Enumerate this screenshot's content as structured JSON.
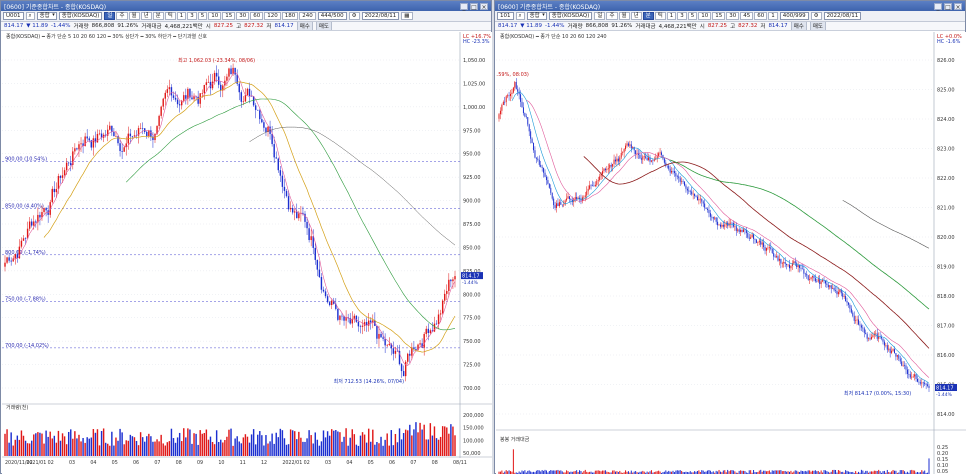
{
  "left_window": {
    "title": "[0600] 기준종합차트 - 종합(KOSDAQ)",
    "toolbar": {
      "code": "U001",
      "market": "종합",
      "name": "종합(KOSDAQ)",
      "period_buttons": [
        "일",
        "주",
        "월",
        "년",
        "분",
        "틱",
        "1",
        "3",
        "5",
        "10",
        "15",
        "30",
        "60",
        "120",
        "180",
        "240"
      ],
      "active_period": "일",
      "count": "444/500",
      "date": "2022/08/11"
    },
    "info_bar": {
      "price": "814.17",
      "change": "▼ 11.89",
      "change_pct": "-1.44%",
      "volume_label": "거래량",
      "volume": "866,808",
      "volume_ratio": "91.26%",
      "amount_label": "거래대금",
      "amount": "4,468,221백만",
      "open_label": "시",
      "open": "827.25",
      "high_label": "고",
      "high": "827.32",
      "low_label": "저",
      "low": "814.17",
      "buttons": [
        "매수",
        "매도"
      ]
    },
    "price_legend": "종합(KOSDAQ) ━ 종가 단순 5 10 20 60 120 ━ 30% 상단가 ━ 30% 하단가 ━ 단기과열 신호",
    "price_axis": [
      "1,050.00",
      "1,025.00",
      "1,000.00",
      "975.00",
      "950.00",
      "925.00",
      "900.00",
      "875.00",
      "850.00",
      "825.00",
      "800.00",
      "775.00",
      "750.00",
      "725.00",
      "700.00"
    ],
    "level_labels": [
      "900.00 (10.54%)",
      "850.00 (4.40%)",
      "800.00 (-1.74%)",
      "750.00 (-7.88%)",
      "700.00 (-14.02%)"
    ],
    "high_annotation": "최고 1,062.03 (-23.34%, 08/06)",
    "low_annotation": "최저 712.53 (14.26%, 07/04)",
    "last_price_tag": "814.17",
    "last_change_tag": "-1.44%",
    "corner_top": "LC +16.7%",
    "corner_sub": "HC -23.3%",
    "volume_legend": "거래량(천)",
    "volume_axis": [
      "200,000",
      "150,000",
      "100,000",
      "50,000"
    ],
    "date_axis": [
      "2020/11/02",
      "2021/01",
      "02",
      "03",
      "04",
      "05",
      "06",
      "07",
      "08",
      "09",
      "10",
      "11",
      "12",
      "2022/01",
      "02",
      "03",
      "04",
      "05",
      "06",
      "07",
      "08",
      "08/11"
    ]
  },
  "right_window": {
    "title": "[0600] 기준종합차트 - 종합(KOSDAQ)",
    "toolbar": {
      "code": "101",
      "market": "종합",
      "name": "종합(KOSDAQ)",
      "period_buttons": [
        "일",
        "주",
        "월",
        "년",
        "분",
        "틱",
        "1",
        "3",
        "5",
        "10",
        "15",
        "30",
        "45",
        "60",
        "1"
      ],
      "active_period": "분",
      "count": "400/999",
      "date": "2022/08/11"
    },
    "info_bar": {
      "price": "814.17",
      "change": "▼ 11.89",
      "change_pct": "-1.44%",
      "volume_label": "거래량",
      "volume": "866,808",
      "volume_ratio": "91.26%",
      "amount_label": "거래대금",
      "amount": "4,468,221백만",
      "open_label": "시",
      "open": "827.25",
      "high_label": "고",
      "high": "827.32",
      "low_label": "저",
      "low": "814.17",
      "buttons": [
        "매수",
        "매도"
      ]
    },
    "price_legend": "종합(KOSDAQ) ━ 종가 단순 10 20 60 120 240",
    "price_axis": [
      "826.00",
      "825.00",
      "824.00",
      "823.00",
      "822.00",
      "821.00",
      "820.00",
      "819.00",
      "818.00",
      "817.00",
      "816.00",
      "815.00",
      "814.00"
    ],
    "high_annotation": "최고 827.32 (-1.59%, 08:03)",
    "low_annotation": "최저 814.17 (0.00%, 15:30)",
    "last_price_tag": "814.17",
    "last_change_tag": "-1.44%",
    "corner_top": "LC +0.0%",
    "corner_sub": "HC -1.6%",
    "volume_legend": "봉봉 거래대금",
    "volume_axis": [
      "0.25",
      "0.20",
      "0.15",
      "0.10",
      "0.05"
    ],
    "date_axis": [
      "08/10",
      "08/10",
      "10",
      "11",
      "12",
      "13",
      "14",
      "15",
      "15:30:00"
    ]
  },
  "colors": {
    "up_candle": "#e01818",
    "down_candle": "#1c2fd0",
    "ma5": "#e05a9a",
    "ma10": "#1a9ad8",
    "ma20": "#d4a017",
    "ma60": "#2c9a3c",
    "ma120": "#8b1a1a",
    "ma240": "#555555",
    "grid": "#d9dde6"
  }
}
